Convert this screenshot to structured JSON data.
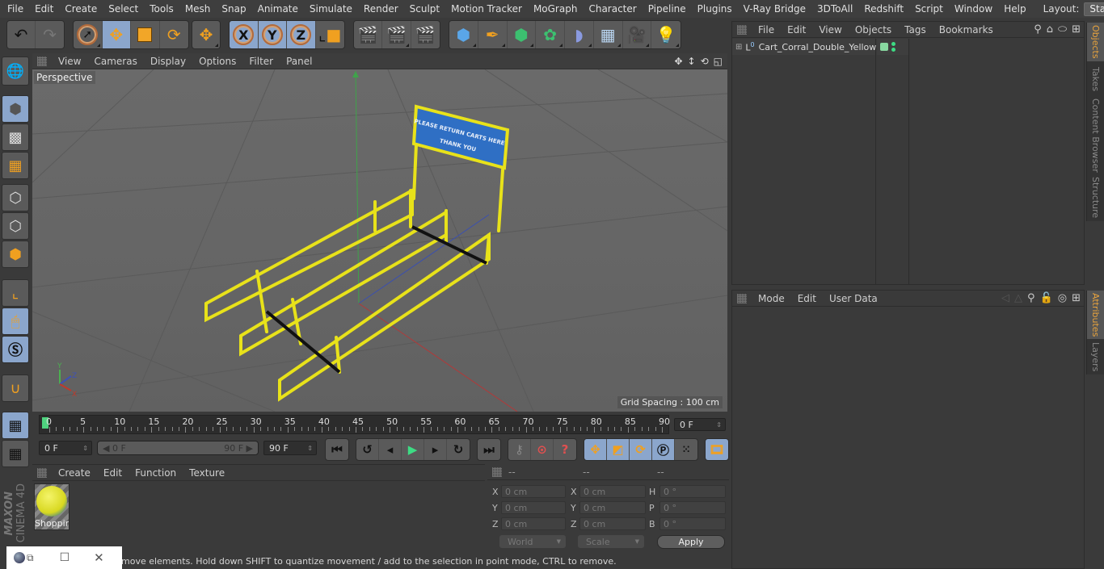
{
  "menubar": {
    "items": [
      "File",
      "Edit",
      "Create",
      "Select",
      "Tools",
      "Mesh",
      "Snap",
      "Animate",
      "Simulate",
      "Render",
      "Sculpt",
      "Motion Tracker",
      "MoGraph",
      "Character",
      "Pipeline",
      "Plugins",
      "V-Ray Bridge",
      "3DToAll",
      "Redshift",
      "Script",
      "Window",
      "Help"
    ],
    "layout_label": "Layout:",
    "layout_value": "Startup"
  },
  "toolbar": {
    "undo": "undo-icon",
    "redo": "redo-icon",
    "axis_x": "X",
    "axis_y": "Y",
    "axis_z": "Z"
  },
  "viewport": {
    "menu": [
      "View",
      "Cameras",
      "Display",
      "Options",
      "Filter",
      "Panel"
    ],
    "camera_label": "Perspective",
    "grid_spacing": "Grid Spacing : 100 cm",
    "sign_line1": "PLEASE RETURN CARTS HERE",
    "sign_line2": "THANK YOU",
    "axis_labels": {
      "x": "X",
      "y": "Y",
      "z": "Z"
    }
  },
  "timeline": {
    "ticks": [
      "0",
      "5",
      "10",
      "15",
      "20",
      "25",
      "30",
      "35",
      "40",
      "45",
      "50",
      "55",
      "60",
      "65",
      "70",
      "75",
      "80",
      "85",
      "90"
    ],
    "current_frame": "0 F",
    "start_field": "0 F",
    "range_start": "0 F",
    "range_end": "90 F",
    "end_field": "90 F"
  },
  "material_panel": {
    "menu": [
      "Create",
      "Edit",
      "Function",
      "Texture"
    ],
    "materials": [
      {
        "name": "Shoppir"
      }
    ]
  },
  "coord_panel": {
    "headers": [
      "--",
      "--",
      "--"
    ],
    "rows": [
      {
        "l1": "X",
        "v1": "0 cm",
        "l2": "X",
        "v2": "0 cm",
        "l3": "H",
        "v3": "0 °"
      },
      {
        "l1": "Y",
        "v1": "0 cm",
        "l2": "Y",
        "v2": "0 cm",
        "l3": "P",
        "v3": "0 °"
      },
      {
        "l1": "Z",
        "v1": "0 cm",
        "l2": "Z",
        "v2": "0 cm",
        "l3": "B",
        "v3": "0 °"
      }
    ],
    "space": "World",
    "mode": "Scale",
    "apply": "Apply"
  },
  "status": {
    "text": "move elements. Hold down SHIFT to quantize movement / add to the selection in point mode, CTRL to remove."
  },
  "objects_panel": {
    "menu": [
      "File",
      "Edit",
      "View",
      "Objects",
      "Tags",
      "Bookmarks"
    ],
    "objects": [
      {
        "name": "Cart_Corral_Double_Yellow",
        "color": "#88d8a0"
      }
    ]
  },
  "attributes_panel": {
    "menu": [
      "Mode",
      "Edit",
      "User Data"
    ]
  },
  "side_tabs": {
    "top": [
      "Objects",
      "Takes",
      "Content Browser",
      "Structure"
    ],
    "bottom": [
      "Attributes",
      "Layers"
    ]
  },
  "branding": {
    "maxon": "MAXON",
    "product": "CINEMA 4D"
  },
  "colors": {
    "accent": "#8ba6cc",
    "highlight_tab": "#e8a33d",
    "frame_marker": "#4fd37f",
    "play": "#3ddc84"
  }
}
